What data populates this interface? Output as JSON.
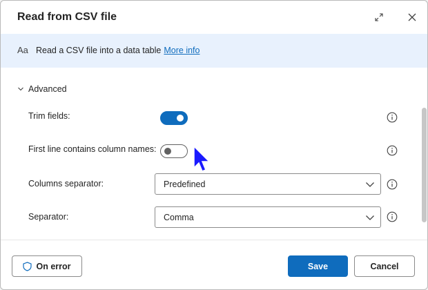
{
  "dialog": {
    "title": "Read from CSV file",
    "header_icons": [
      "expand-icon",
      "close-icon"
    ]
  },
  "info_bar": {
    "icon": "text-aa-icon",
    "icon_text": "Aa",
    "description": "Read a CSV file into a data table",
    "link": "More info"
  },
  "advanced": {
    "label": "Advanced",
    "expanded": true
  },
  "fields": {
    "trim_fields": {
      "label": "Trim fields:",
      "value": true
    },
    "first_line": {
      "label": "First line contains column names:",
      "value": false
    },
    "columns_separator": {
      "label": "Columns separator:",
      "value": "Predefined"
    },
    "separator": {
      "label": "Separator:",
      "value": "Comma"
    }
  },
  "footer": {
    "on_error": "On error",
    "save": "Save",
    "cancel": "Cancel"
  },
  "colors": {
    "accent": "#0f6cbd",
    "info_bar_bg": "#e8f1fd",
    "cursor": "#1a1aff"
  }
}
